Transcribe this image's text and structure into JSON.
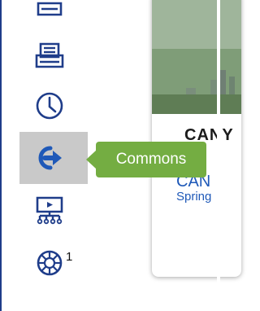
{
  "sidebar": {
    "icons": [
      {
        "name": "bookmark-partial-icon",
        "active": false
      },
      {
        "name": "printer-icon",
        "active": false
      },
      {
        "name": "clock-icon",
        "active": false
      },
      {
        "name": "sign-out-icon",
        "active": true
      },
      {
        "name": "presentation-network-icon",
        "active": false
      },
      {
        "name": "pathways-icon",
        "active": false
      }
    ],
    "pathways_badge": "1"
  },
  "tooltip": {
    "text": "Commons"
  },
  "card": {
    "title_partial": "CANY",
    "subtitle_partial": "CAN",
    "link_partial": "Spring"
  },
  "colors": {
    "accent_blue": "#1f59b8",
    "tooltip_green": "#74ad42",
    "active_bg": "#c9c9c9"
  }
}
